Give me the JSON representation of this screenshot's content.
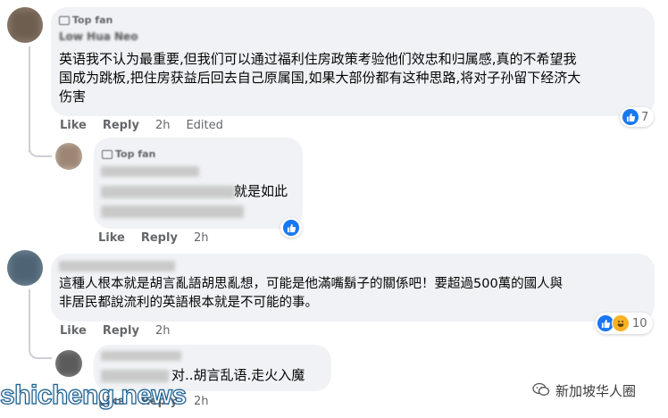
{
  "comments": [
    {
      "badge": "Top fan",
      "author": "Low Hua Neo",
      "text_line1": "英语我不认为最重要,但我们可以通过福利住房政策考验他们效忠和归属感,真的不希望我",
      "text_line2": "国成为跳板,把住房获益后回去自己原属国,如果大部份都有这种思路,将对子孙留下经济大",
      "text_line3": "伤害",
      "like": "Like",
      "reply": "Reply",
      "time": "2h",
      "edited": "Edited",
      "reaction_count": "7"
    },
    {
      "badge": "Top fan",
      "text_visible": "就是如此",
      "like": "Like",
      "reply": "Reply",
      "time": "2h"
    },
    {
      "text_line1": "這種人根本就是胡言亂語胡思亂想，可能是他滿嘴鬍子的關係吧！要超過500萬的國人與",
      "text_line2": "非居民都說流利的英語根本就是不可能的事。",
      "like": "Like",
      "reply": "Reply",
      "time": "2h",
      "reaction_count": "10"
    },
    {
      "text_visible": "对..胡言乱语.走火入魔",
      "like": "Like",
      "reply": "Reply",
      "time": "2h"
    }
  ],
  "watermark": {
    "left": "shicheng.news",
    "right": "新加坡华人圈"
  },
  "colors": {
    "like_blue": "#1877f2",
    "bubble_bg": "#f0f2f5",
    "meta_gray": "#65676b"
  }
}
